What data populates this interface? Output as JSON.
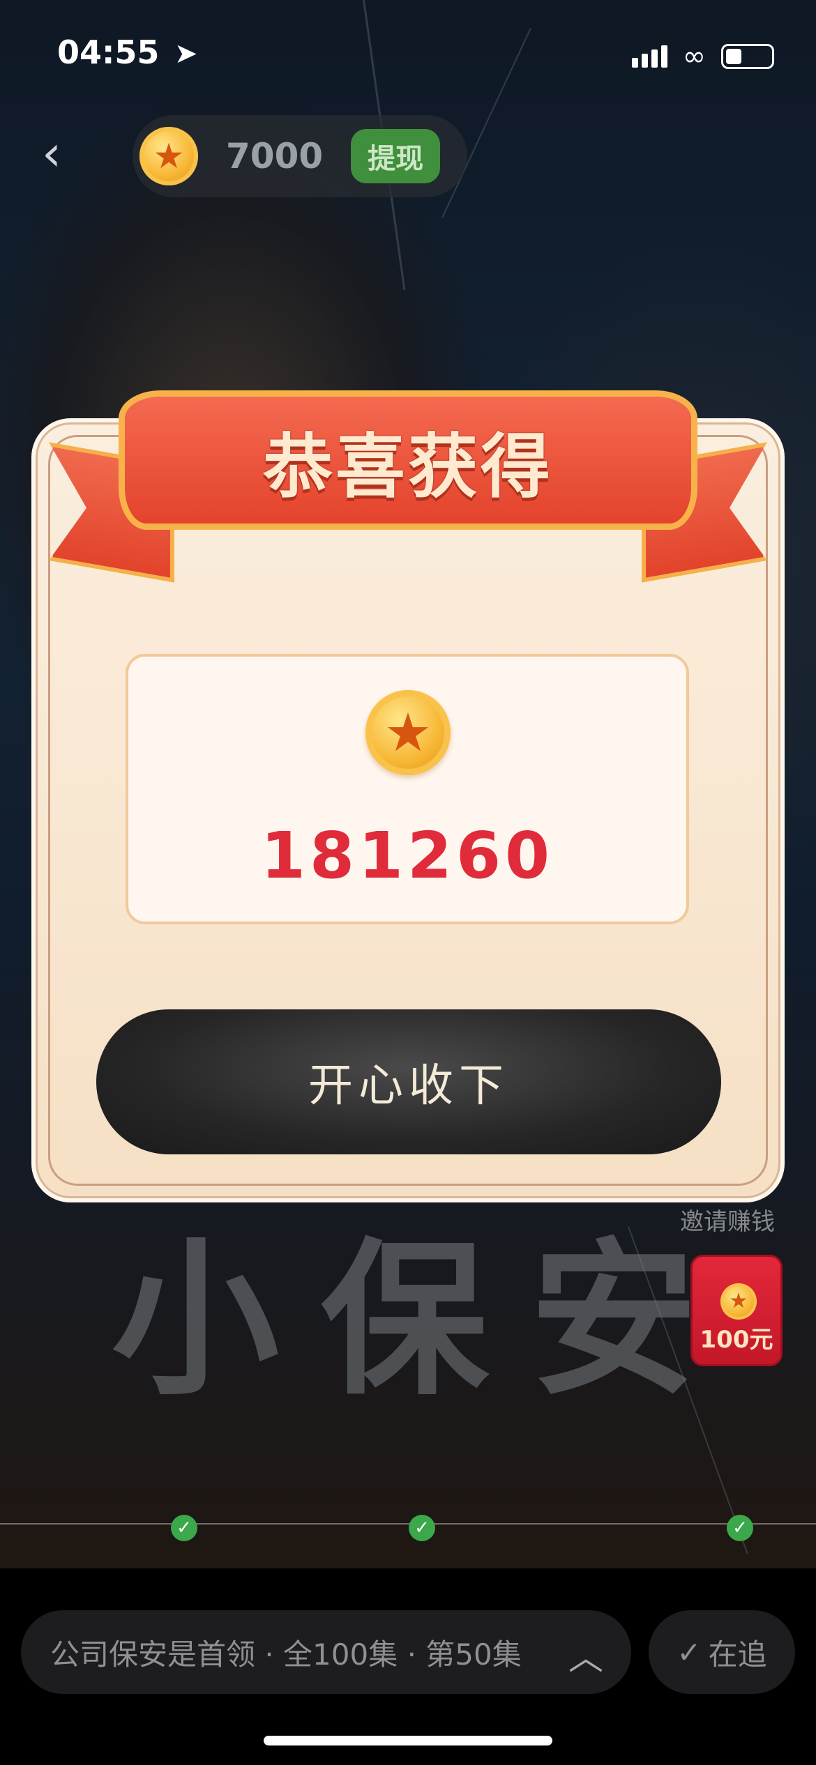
{
  "status_bar": {
    "time": "04:55"
  },
  "top_bar": {
    "coin_balance": "7000",
    "withdraw_label": "提现"
  },
  "background": {
    "poster_text": "小保安"
  },
  "modal": {
    "title": "恭喜获得",
    "reward_amount": "181260",
    "accept_label": "开心收下"
  },
  "side_widgets": {
    "invite_label": "邀请赚钱",
    "red_envelope_label": "100元"
  },
  "bottom_bar": {
    "series_info": "公司保安是首领 · 全100集 · 第50集",
    "follow_label": "在追"
  },
  "colors": {
    "reward_red": "#e02b3a",
    "ribbon_red": "#e4432c",
    "withdraw_green": "#3f8f3c",
    "button_dark": "#262626"
  },
  "icons": [
    "back-chevron-icon",
    "coin-icon",
    "location-arrow-icon",
    "signal-icon",
    "link-icon",
    "battery-icon",
    "chevron-up-icon",
    "checkmark-icon"
  ]
}
